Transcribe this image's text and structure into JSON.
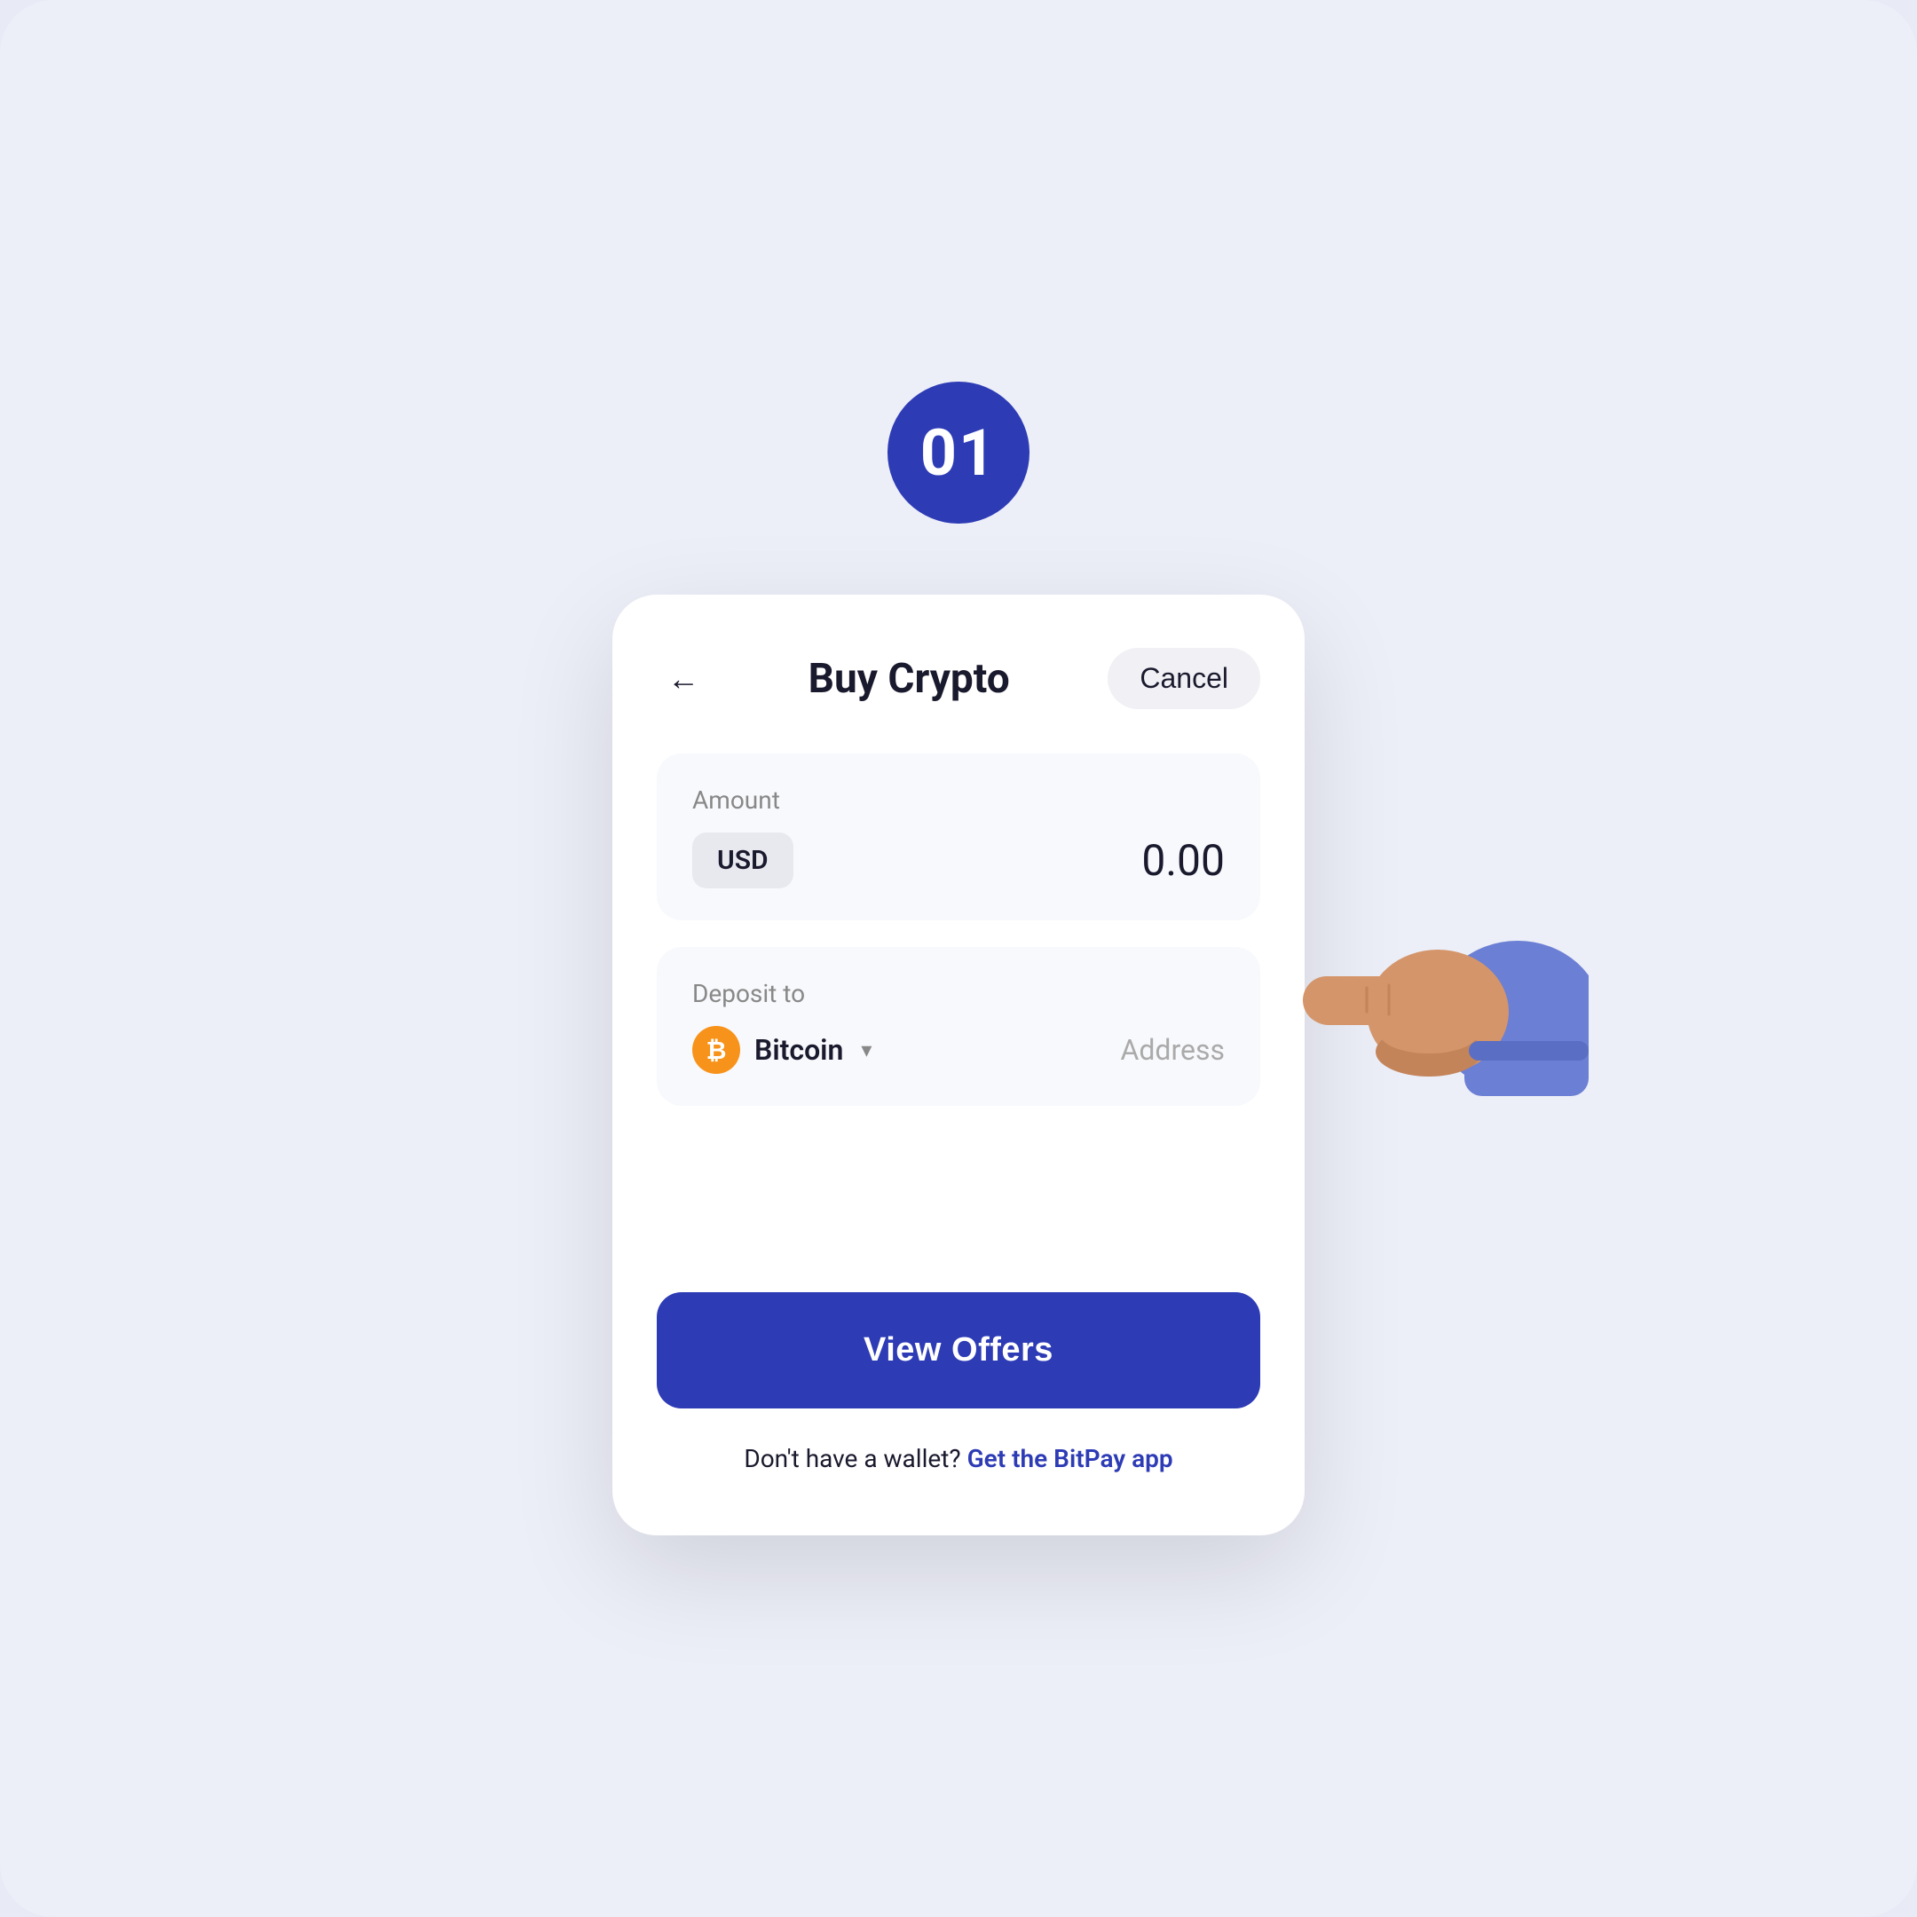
{
  "page": {
    "background_color": "#eceef8",
    "step_number": "01"
  },
  "header": {
    "title": "Buy Crypto",
    "cancel_label": "Cancel",
    "back_icon": "←"
  },
  "amount_section": {
    "label": "Amount",
    "currency": "USD",
    "value": "0.00"
  },
  "deposit_section": {
    "label": "Deposit to",
    "coin_name": "Bitcoin",
    "coin_symbol": "₿",
    "address_placeholder": "Address"
  },
  "cta": {
    "button_label": "View Offers"
  },
  "footer": {
    "text": "Don't have a wallet?",
    "link_text": "Get the BitPay app"
  }
}
